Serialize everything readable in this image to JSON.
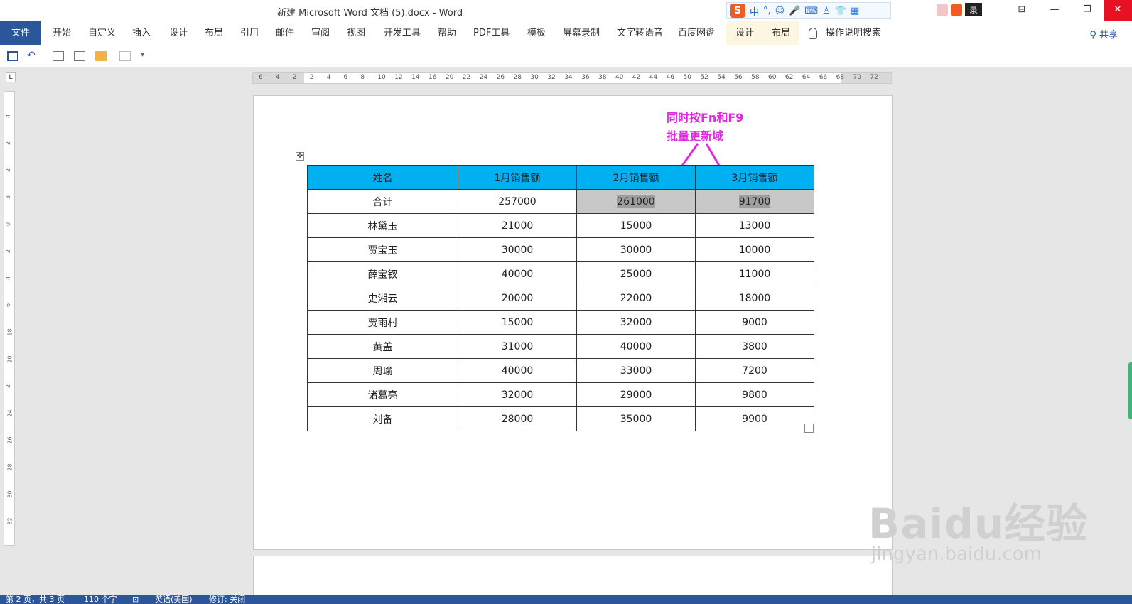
{
  "window": {
    "title": "新建 Microsoft Word 文档 (5).docx  -  Word",
    "ime_logo": "S",
    "ime_mode": "中",
    "ime_punct": "°,",
    "tray_login": "录",
    "btn_ribbon_display": "⊟",
    "btn_minimize": "—",
    "btn_restore": "❐",
    "btn_close": "✕"
  },
  "ribbon": {
    "file": "文件",
    "tabs": [
      "开始",
      "自定义",
      "插入",
      "设计",
      "布局",
      "引用",
      "邮件",
      "审阅",
      "视图",
      "开发工具",
      "帮助",
      "PDF工具",
      "模板",
      "屏幕录制",
      "文字转语音",
      "百度网盘"
    ],
    "context_tabs": [
      "设计",
      "布局"
    ],
    "tell_me": "操作说明搜索",
    "share": "共享"
  },
  "ruler": {
    "horizontal": [
      "6",
      "4",
      "2",
      "2",
      "4",
      "6",
      "8",
      "10",
      "12",
      "14",
      "16",
      "20",
      "22",
      "24",
      "26",
      "28",
      "30",
      "32",
      "34",
      "36",
      "38",
      "40",
      "42",
      "44",
      "46",
      "50",
      "52",
      "54",
      "56",
      "58",
      "60",
      "62",
      "64",
      "66",
      "68",
      "70",
      "72"
    ],
    "vertical": [
      "4",
      "2",
      "2",
      "3",
      "0",
      "2",
      "4",
      "6",
      "18",
      "20",
      "2",
      "24",
      "26",
      "28",
      "30",
      "32"
    ],
    "corner": "L"
  },
  "annotation": {
    "line1": "同时按Fn和F9",
    "line2": "批量更新域",
    "color": "#e028e0"
  },
  "table": {
    "header_color": "#00b0f0",
    "headers": [
      "姓名",
      "1月销售额",
      "2月销售额",
      "3月销售额"
    ],
    "rows": [
      [
        "合计",
        "257000",
        "261000",
        "91700"
      ],
      [
        "林黛玉",
        "21000",
        "15000",
        "13000"
      ],
      [
        "贾宝玉",
        "30000",
        "30000",
        "10000"
      ],
      [
        "薛宝钗",
        "40000",
        "25000",
        "11000"
      ],
      [
        "史湘云",
        "20000",
        "22000",
        "18000"
      ],
      [
        "贾雨村",
        "15000",
        "32000",
        "9000"
      ],
      [
        "黄盖",
        "31000",
        "40000",
        "3800"
      ],
      [
        "周瑜",
        "40000",
        "33000",
        "7200"
      ],
      [
        "诸葛亮",
        "32000",
        "29000",
        "9800"
      ],
      [
        "刘备",
        "28000",
        "35000",
        "9900"
      ]
    ]
  },
  "status": {
    "page": "第 2 页，共 3 页",
    "words": "110 个字",
    "language": "英语(美国)",
    "track": "修订: 关闭"
  },
  "watermark": {
    "line1": "Baidu经验",
    "line2": "jingyan.baidu.com"
  }
}
